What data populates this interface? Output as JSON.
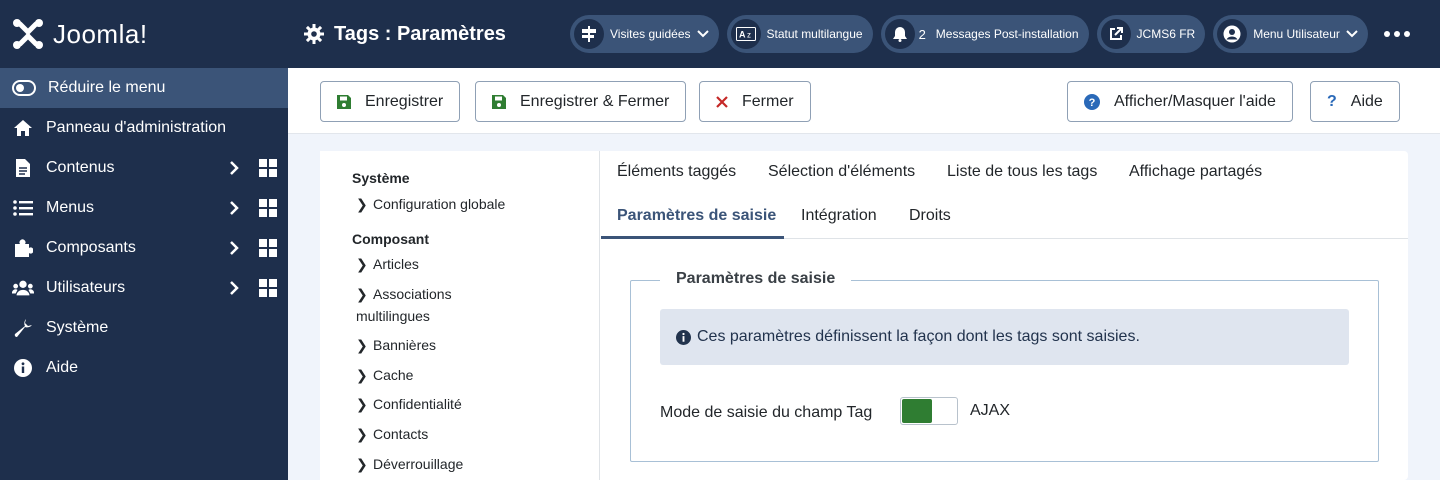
{
  "brand": {
    "name": "Joomla!"
  },
  "header": {
    "title": "Tags : Paramètres",
    "pills": [
      {
        "label": "Visites guidées",
        "icon": "signpost-icon"
      },
      {
        "label": "Statut multilangue",
        "icon": "language-icon"
      },
      {
        "count": "2",
        "label": "Messages Post-installation",
        "icon": "bell-icon"
      },
      {
        "label": "JCMS6 FR",
        "icon": "external-link-icon"
      },
      {
        "label": "Menu Utilisateur",
        "icon": "user-icon"
      }
    ]
  },
  "sidebar": {
    "collapse_label": "Réduire le menu",
    "items": [
      {
        "label": "Panneau d'administration",
        "icon": "home-icon"
      },
      {
        "label": "Contenus",
        "icon": "file-icon"
      },
      {
        "label": "Menus",
        "icon": "list-icon"
      },
      {
        "label": "Composants",
        "icon": "puzzle-icon"
      },
      {
        "label": "Utilisateurs",
        "icon": "users-icon"
      },
      {
        "label": "Système",
        "icon": "wrench-icon"
      },
      {
        "label": "Aide",
        "icon": "info-icon"
      }
    ]
  },
  "toolbar": {
    "save": "Enregistrer",
    "save_close": "Enregistrer & Fermer",
    "close": "Fermer",
    "toggle_help": "Afficher/Masquer l'aide",
    "help": "Aide"
  },
  "tree": {
    "system_heading": "Système",
    "system_items": [
      "Configuration globale"
    ],
    "component_heading": "Composant",
    "component_items": [
      "Articles",
      "Associations",
      "multilingues",
      "Bannières",
      "Cache",
      "Confidentialité",
      "Contacts",
      "Déverrouillage"
    ]
  },
  "tabs": {
    "row1": [
      "Éléments taggés",
      "Sélection d'éléments",
      "Liste de tous les tags",
      "Affichage partagés"
    ],
    "row2": [
      "Paramètres de saisie",
      "Intégration",
      "Droits"
    ]
  },
  "form": {
    "legend": "Paramètres de saisie",
    "info": "Ces paramètres définissent la façon dont les tags sont saisies.",
    "field_label": "Mode de saisie du champ Tag",
    "field_value": "AJAX"
  },
  "colors": {
    "sidebar_bg": "#1e2f4c",
    "accent": "#3b5478",
    "switch_on": "#2f7d32"
  }
}
